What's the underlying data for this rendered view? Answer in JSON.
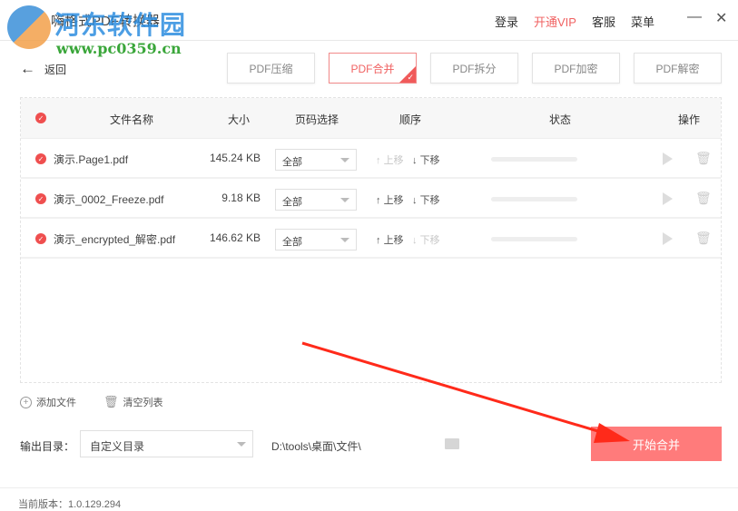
{
  "header": {
    "app_title": "嗨格式PDF转换器",
    "watermark_name": "河东软件园",
    "watermark_url": "www.pc0359.cn",
    "nav": [
      "登录",
      "开通VIP",
      "客服",
      "菜单"
    ],
    "minimize": "—",
    "close": "✕"
  },
  "back_label": "返回",
  "tabs": [
    {
      "label": "PDF压缩"
    },
    {
      "label": "PDF合并",
      "active": true
    },
    {
      "label": "PDF拆分"
    },
    {
      "label": "PDF加密"
    },
    {
      "label": "PDF解密"
    }
  ],
  "table": {
    "headers": {
      "name": "文件名称",
      "size": "大小",
      "pages": "页码选择",
      "order": "顺序",
      "status": "状态",
      "action": "操作"
    },
    "rows": [
      {
        "name": "演示.Page1.pdf",
        "size": "145.24 KB",
        "pages": "全部",
        "up": "上移",
        "down": "下移",
        "up_enabled": false,
        "down_enabled": true
      },
      {
        "name": "演示_0002_Freeze.pdf",
        "size": "9.18 KB",
        "pages": "全部",
        "up": "上移",
        "down": "下移",
        "up_enabled": true,
        "down_enabled": true
      },
      {
        "name": "演示_encrypted_解密.pdf",
        "size": "146.62 KB",
        "pages": "全部",
        "up": "上移",
        "down": "下移",
        "up_enabled": true,
        "down_enabled": false
      }
    ]
  },
  "tools": {
    "add": "添加文件",
    "clear": "清空列表"
  },
  "output": {
    "label": "输出目录：",
    "select": "自定义目录",
    "path": "D:\\tools\\桌面\\文件\\"
  },
  "start_button": "开始合并",
  "version": "当前版本：1.0.129.294",
  "colors": {
    "accent": "#f05a5a",
    "start": "#ff7b7b",
    "annotation_arrow": "#ff2a1a"
  }
}
